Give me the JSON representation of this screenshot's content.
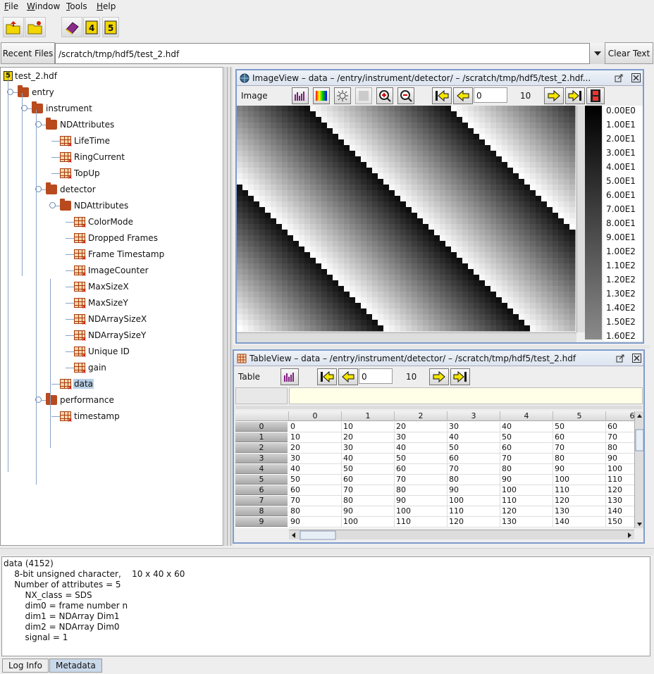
{
  "menubar": {
    "items": [
      {
        "label": "File",
        "mnemonic": "F",
        "rest": "ile"
      },
      {
        "label": "Window",
        "mnemonic": "W",
        "rest": "indow"
      },
      {
        "label": "Tools",
        "mnemonic": "T",
        "rest": "ools"
      },
      {
        "label": "Help",
        "mnemonic": "H",
        "rest": "elp"
      }
    ]
  },
  "toolbar": {
    "buttons": [
      "open-file-icon",
      "open-remote-icon",
      "users-guide-icon",
      "hdf4-icon",
      "hdf5-icon"
    ]
  },
  "recent": {
    "button_label": "Recent Files",
    "path": "/scratch/tmp/hdf5/test_2.hdf",
    "clear_label": "Clear Text"
  },
  "tree": {
    "root": "test_2.hdf",
    "nodes": [
      {
        "label": "entry",
        "type": "group",
        "depth": 1
      },
      {
        "label": "instrument",
        "type": "group",
        "depth": 2
      },
      {
        "label": "NDAttributes",
        "type": "group",
        "depth": 3
      },
      {
        "label": "LifeTime",
        "type": "dataset",
        "depth": 4
      },
      {
        "label": "RingCurrent",
        "type": "dataset",
        "depth": 4
      },
      {
        "label": "TopUp",
        "type": "dataset",
        "depth": 4
      },
      {
        "label": "detector",
        "type": "group",
        "depth": 3
      },
      {
        "label": "NDAttributes",
        "type": "group",
        "depth": 4
      },
      {
        "label": "ColorMode",
        "type": "dataset",
        "depth": 5
      },
      {
        "label": "Dropped Frames",
        "type": "dataset",
        "depth": 5
      },
      {
        "label": "Frame Timestamp",
        "type": "dataset",
        "depth": 5
      },
      {
        "label": "ImageCounter",
        "type": "dataset",
        "depth": 5
      },
      {
        "label": "MaxSizeX",
        "type": "dataset",
        "depth": 5
      },
      {
        "label": "MaxSizeY",
        "type": "dataset",
        "depth": 5
      },
      {
        "label": "NDArraySizeX",
        "type": "dataset",
        "depth": 5
      },
      {
        "label": "NDArraySizeY",
        "type": "dataset",
        "depth": 5
      },
      {
        "label": "Unique ID",
        "type": "dataset",
        "depth": 5
      },
      {
        "label": "gain",
        "type": "dataset",
        "depth": 5
      },
      {
        "label": "data",
        "type": "dataset",
        "depth": 4,
        "selected": true
      },
      {
        "label": "performance",
        "type": "group",
        "depth": 3
      },
      {
        "label": "timestamp",
        "type": "dataset",
        "depth": 4
      }
    ]
  },
  "imageview": {
    "title": "ImageView  –  data  –  /entry/instrument/detector/  –  /scratch/tmp/hdf5/test_2.hdf...",
    "menu_label": "Image",
    "frame_value": "0",
    "frame_count": "10",
    "palette_labels": [
      "0.00E0",
      "1.00E1",
      "2.00E1",
      "3.00E1",
      "4.00E1",
      "5.00E1",
      "6.00E1",
      "7.00E1",
      "8.00E1",
      "9.00E1",
      "1.00E2",
      "1.10E2",
      "1.20E2",
      "1.30E2",
      "1.40E2",
      "1.50E2",
      "1.60E2"
    ]
  },
  "tableview": {
    "title": "TableView  –  data  –  /entry/instrument/detector/  –  /scratch/tmp/hdf5/test_2.hdf",
    "menu_label": "Table",
    "frame_value": "0",
    "frame_count": "10",
    "cell_label": "",
    "cell_value": "",
    "columns": [
      "0",
      "1",
      "2",
      "3",
      "4",
      "5",
      "6"
    ],
    "rows": [
      {
        "index": "0",
        "cells": [
          "0",
          "10",
          "20",
          "30",
          "40",
          "50",
          "60"
        ]
      },
      {
        "index": "1",
        "cells": [
          "10",
          "20",
          "30",
          "40",
          "50",
          "60",
          "70"
        ]
      },
      {
        "index": "2",
        "cells": [
          "20",
          "30",
          "40",
          "50",
          "60",
          "70",
          "80"
        ]
      },
      {
        "index": "3",
        "cells": [
          "30",
          "40",
          "50",
          "60",
          "70",
          "80",
          "90"
        ]
      },
      {
        "index": "4",
        "cells": [
          "40",
          "50",
          "60",
          "70",
          "80",
          "90",
          "100"
        ]
      },
      {
        "index": "5",
        "cells": [
          "50",
          "60",
          "70",
          "80",
          "90",
          "100",
          "110"
        ]
      },
      {
        "index": "6",
        "cells": [
          "60",
          "70",
          "80",
          "90",
          "100",
          "110",
          "120"
        ]
      },
      {
        "index": "7",
        "cells": [
          "70",
          "80",
          "90",
          "100",
          "110",
          "120",
          "130"
        ]
      },
      {
        "index": "8",
        "cells": [
          "80",
          "90",
          "100",
          "110",
          "120",
          "130",
          "140"
        ]
      },
      {
        "index": "9",
        "cells": [
          "90",
          "100",
          "110",
          "120",
          "130",
          "140",
          "150"
        ]
      }
    ]
  },
  "info": {
    "lines": [
      "data (4152)",
      "    8-bit unsigned character,    10 x 40 x 60",
      "    Number of attributes = 5",
      "        NX_class = SDS",
      "        dim0 = frame number n",
      "        dim1 = NDArray Dim1",
      "        dim2 = NDArray Dim0",
      "        signal = 1"
    ]
  },
  "bottom_tabs": [
    "Log Info",
    "Metadata"
  ],
  "colors": {
    "frame_border": "#7d9ccc",
    "selection": "#b8cfe5",
    "folder": "#b84a1e",
    "arrow_yellow": "#f5e600"
  }
}
